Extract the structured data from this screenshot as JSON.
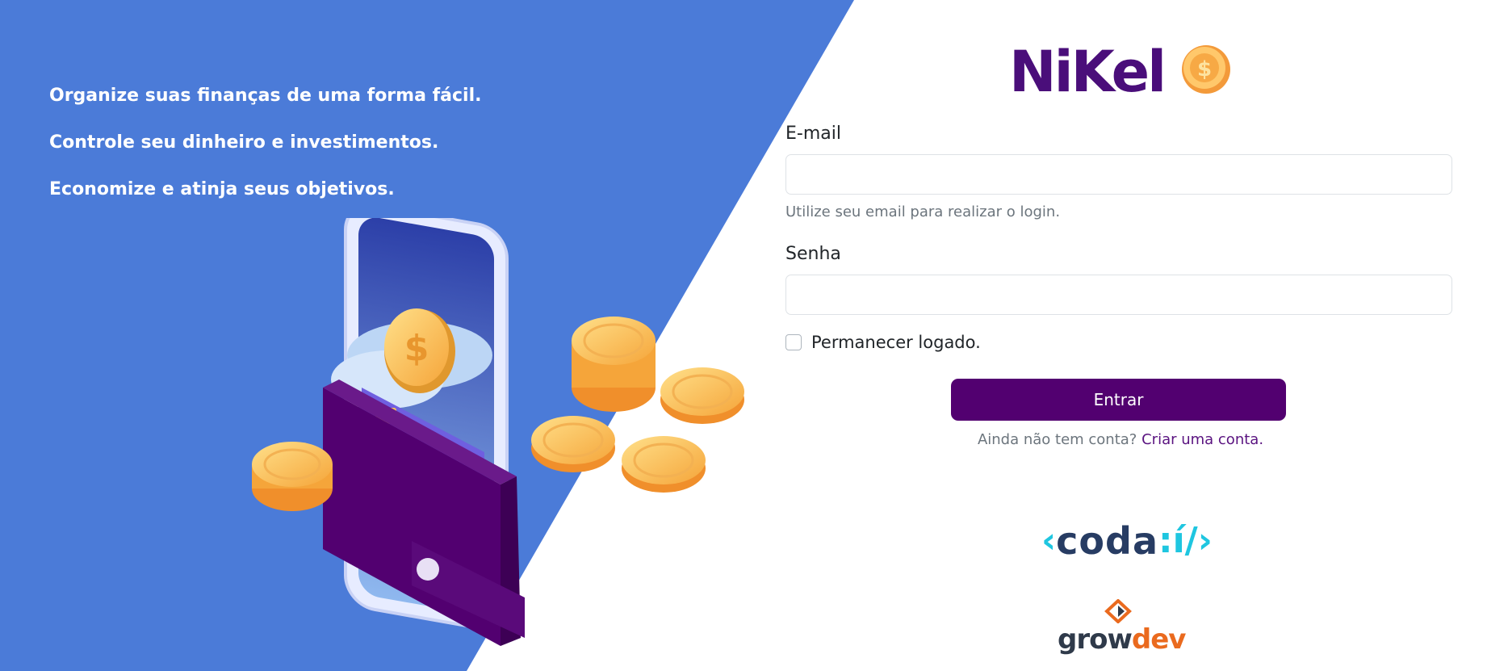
{
  "colors": {
    "panel_blue": "#4b7bd8",
    "brand_purple": "#520070",
    "link_purple": "#5a1380",
    "coda_cyan": "#1fc6e0",
    "growdev_orange": "#ea6a1e"
  },
  "hero": {
    "taglines": [
      "Organize suas finanças de uma forma fácil.",
      "Controle seu dinheiro e investimentos.",
      "Economize e atinja seus objetivos."
    ],
    "illustration": "wallet-phone-coins-illustration"
  },
  "brand": {
    "logo_text": "NiKel",
    "coin_symbol": "$"
  },
  "form": {
    "email_label": "E-mail",
    "email_value": "",
    "email_placeholder": "",
    "email_help": "Utilize seu email para realizar o login.",
    "password_label": "Senha",
    "password_value": "",
    "password_placeholder": "",
    "remember_label": "Permanecer logado.",
    "remember_checked": false,
    "submit_label": "Entrar",
    "signup_prompt": "Ainda não tem conta?",
    "signup_link": "Criar uma conta."
  },
  "partners": {
    "coda_open": "‹",
    "coda_text": "coda",
    "coda_suffix": ":í/›",
    "growdev_grow": "grow",
    "growdev_dev": "dev"
  }
}
